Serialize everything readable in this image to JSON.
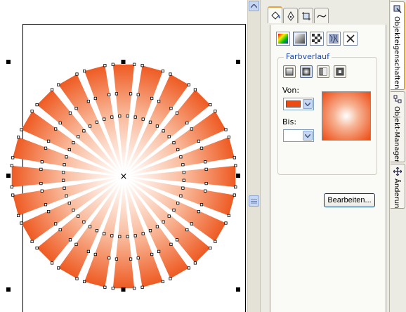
{
  "canvas": {
    "center_marker": "×",
    "burst": {
      "rays": 24,
      "color_from": "#ee5a22",
      "color_to": "#ffffff",
      "fill_type": "radial"
    }
  },
  "panel": {
    "tool_tabs": [
      {
        "name": "fill-tab",
        "icon": "paint-bucket-icon",
        "active": true
      },
      {
        "name": "outline-tab",
        "icon": "pen-nib-icon",
        "active": false
      },
      {
        "name": "transform-tab",
        "icon": "crop-icon",
        "active": false
      },
      {
        "name": "curve-tab",
        "icon": "curve-icon",
        "active": false
      }
    ],
    "fill_types": [
      {
        "name": "uniform-fill",
        "icon": "color-wheel-icon",
        "active": false
      },
      {
        "name": "fountain-fill",
        "icon": "fountain-fill-icon",
        "active": true
      },
      {
        "name": "pattern-fill",
        "icon": "pattern-fill-icon",
        "active": false
      },
      {
        "name": "texture-fill",
        "icon": "texture-fill-icon",
        "active": false
      },
      {
        "name": "no-fill",
        "icon": "x-icon",
        "active": false
      }
    ],
    "gradient": {
      "legend": "Farbverlauf",
      "types": [
        {
          "name": "linear",
          "icon": "linear-gradient-icon",
          "active": false
        },
        {
          "name": "radial",
          "icon": "radial-gradient-icon",
          "active": true
        },
        {
          "name": "conical",
          "icon": "conical-gradient-icon",
          "active": false
        },
        {
          "name": "square",
          "icon": "square-gradient-icon",
          "active": false
        }
      ],
      "from_label": "Von:",
      "from_color": "#ec4b12",
      "to_label": "Bis:",
      "to_color": "#ffffff"
    },
    "edit_button": "Bearbeiten..."
  },
  "side_tabs": [
    {
      "label": "Objekteigenschaften",
      "icon": "object-properties-icon",
      "active": true
    },
    {
      "label": "Objekt-Manager",
      "icon": "object-manager-icon",
      "active": false
    },
    {
      "label": "Änderung",
      "icon": "transform-icon",
      "active": false
    }
  ]
}
